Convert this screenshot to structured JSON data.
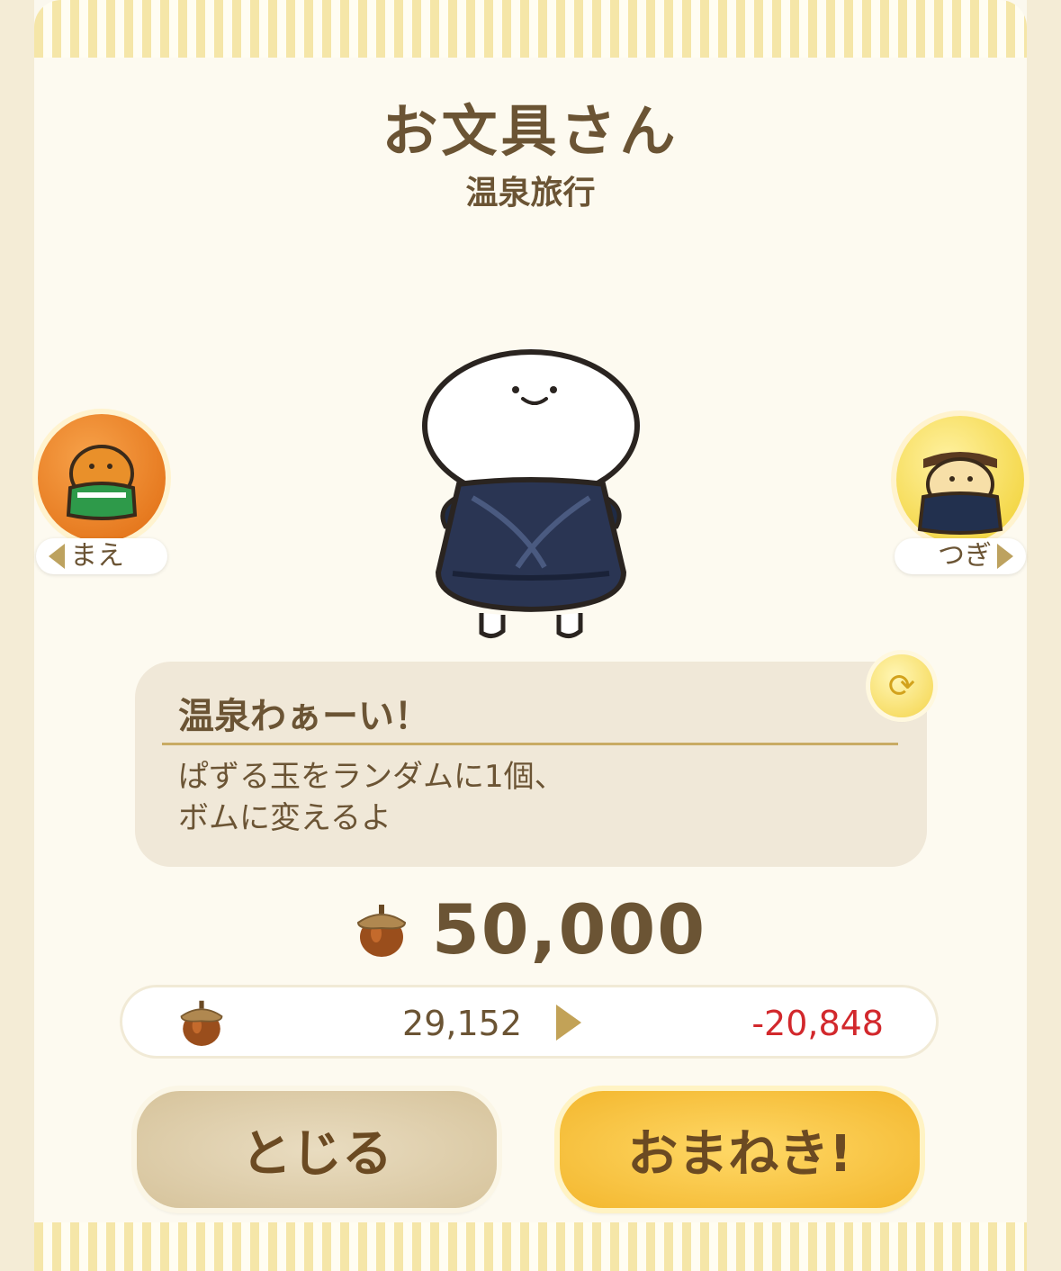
{
  "header": {
    "title": "お文具さん",
    "subtitle": "温泉旅行"
  },
  "nav": {
    "prev_label": "まえ",
    "next_label": "つぎ"
  },
  "skill": {
    "name": "温泉わぁーい！",
    "description_line1": "ぱずる玉をランダムに1個、",
    "description_line2": "ボムに変えるよ"
  },
  "price": {
    "cost": "50,000",
    "currency_icon": "acorn-icon"
  },
  "balance": {
    "current": "29,152",
    "difference": "-20,848"
  },
  "buttons": {
    "close_label": "とじる",
    "invite_label": "おまねき!"
  },
  "colors": {
    "text_brown": "#6b5434",
    "negative_red": "#d2282c",
    "invite_yellow": "#f3b72e",
    "close_beige": "#d6c39b"
  }
}
